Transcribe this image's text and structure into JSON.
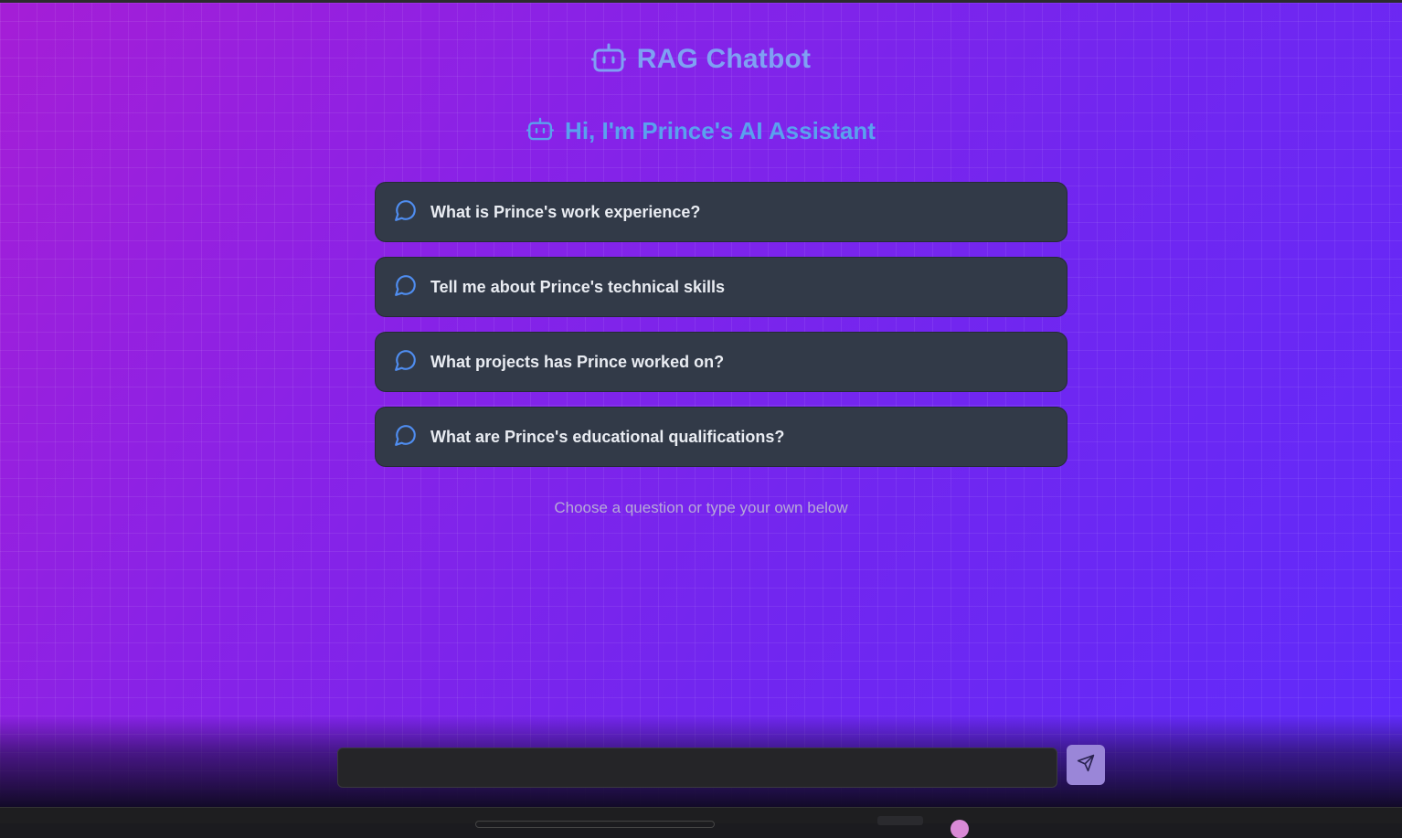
{
  "app": {
    "title": "RAG Chatbot",
    "title_icon": "robot-icon"
  },
  "greeting": {
    "text": "Hi, I'm Prince's AI Assistant",
    "icon": "robot-icon"
  },
  "questions": [
    {
      "label": "What is Prince's work experience?",
      "icon": "chat-bubble-icon"
    },
    {
      "label": "Tell me about Prince's technical skills",
      "icon": "chat-bubble-icon"
    },
    {
      "label": "What projects has Prince worked on?",
      "icon": "chat-bubble-icon"
    },
    {
      "label": "What are Prince's educational qualifications?",
      "icon": "chat-bubble-icon"
    }
  ],
  "hint": "Choose a question or type your own below",
  "composer": {
    "value": "",
    "placeholder": "",
    "send_icon": "send-icon"
  },
  "colors": {
    "title": "#7fa0f3",
    "greeting": "#5aa1ee",
    "card_bg": "#323a48",
    "icon_blue": "#4f8df0",
    "send_button": "#9a86d8"
  }
}
